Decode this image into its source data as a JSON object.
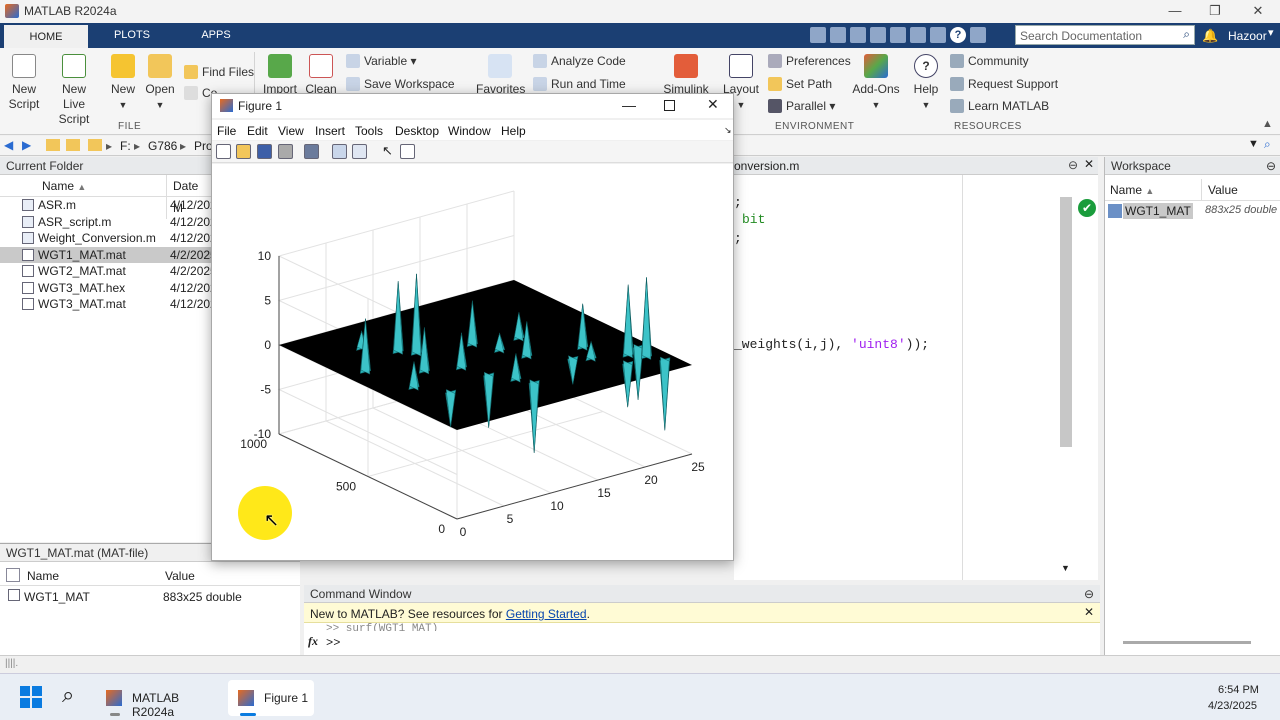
{
  "app": {
    "title": "MATLAB R2024a"
  },
  "tabs": [
    {
      "label": "HOME"
    },
    {
      "label": "PLOTS"
    },
    {
      "label": "APPS"
    }
  ],
  "search": {
    "placeholder": "Search Documentation"
  },
  "user": {
    "name": "Hazoor"
  },
  "ribbon": {
    "file": {
      "new_script": "New\nScript",
      "new_live": "New\nLive Script",
      "new": "New",
      "open": "Open",
      "find_files": "Find Files",
      "compare": "Co",
      "group": "FILE"
    },
    "variable": {
      "import": "Import",
      "clean": "Clean",
      "variable": "Variable",
      "save_ws": "Save Workspace"
    },
    "code": {
      "favorites": "Favorites",
      "analyze": "Analyze Code",
      "run_time": "Run and Time"
    },
    "simulink": {
      "label": "Simulink"
    },
    "env": {
      "layout": "Layout",
      "preferences": "Preferences",
      "set_path": "Set Path",
      "parallel": "Parallel",
      "addons": "Add-Ons",
      "group": "ENVIRONMENT"
    },
    "resources": {
      "help": "Help",
      "community": "Community",
      "request_support": "Request Support",
      "learn": "Learn MATLAB",
      "group": "RESOURCES"
    }
  },
  "address": {
    "drive": "F:",
    "folder1": "G786",
    "folder2": "Pro"
  },
  "current_folder": {
    "title": "Current Folder",
    "col_name": "Name",
    "col_date": "Date M",
    "files": [
      {
        "name": "ASR.m",
        "date": "4/12/202"
      },
      {
        "name": "ASR_script.m",
        "date": "4/12/202"
      },
      {
        "name": "Weight_Conversion.m",
        "date": "4/12/202"
      },
      {
        "name": "WGT1_MAT.mat",
        "date": "4/2/2025"
      },
      {
        "name": "WGT2_MAT.mat",
        "date": "4/2/2025"
      },
      {
        "name": "WGT3_MAT.hex",
        "date": "4/12/202"
      },
      {
        "name": "WGT3_MAT.mat",
        "date": "4/12/202"
      }
    ]
  },
  "details": {
    "title": "WGT1_MAT.mat  (MAT-file)",
    "col_name": "Name",
    "col_value": "Value",
    "var_name": "WGT1_MAT",
    "var_value": "883x25 double"
  },
  "editor": {
    "tab": "onversion.m",
    "line1": ";",
    "line2": "bit",
    "line3": ";",
    "line4_a": "_weights(i,j), ",
    "line4_b": "'uint8'",
    "line4_c": "));"
  },
  "workspace": {
    "title": "Workspace",
    "col_name": "Name",
    "col_value": "Value",
    "var_name": "WGT1_MAT",
    "var_value": "883x25 double"
  },
  "command": {
    "title": "Command Window",
    "banner": "New to MATLAB? See resources for ",
    "banner_link": "Getting Started",
    "banner_end": ".",
    "history": ">> surf(WGT1_MAT)",
    "prompt": ">>",
    "fx": "fx"
  },
  "figure": {
    "title": "Figure 1",
    "menu": [
      "File",
      "Edit",
      "View",
      "Insert",
      "Tools",
      "Desktop",
      "Window",
      "Help"
    ],
    "surface_color": "#27b0b6"
  },
  "chart_data": {
    "type": "surface",
    "title": "",
    "xlabel": "",
    "ylabel": "",
    "zlabel": "",
    "x_ticks": [
      "0",
      "5",
      "10",
      "15",
      "20",
      "25"
    ],
    "y_ticks": [
      "0",
      "500",
      "1000"
    ],
    "z_ticks": [
      "-10",
      "-5",
      "0",
      "5",
      "10"
    ],
    "xlim": [
      0,
      25
    ],
    "ylim": [
      0,
      1000
    ],
    "zlim": [
      -10,
      10
    ],
    "grid": true,
    "spikes": [
      {
        "x": 2,
        "y": 620,
        "z": 6
      },
      {
        "x": 3,
        "y": 400,
        "z": 3
      },
      {
        "x": 5,
        "y": 300,
        "z": -4
      },
      {
        "x": 6,
        "y": 500,
        "z": 5
      },
      {
        "x": 7,
        "y": 700,
        "z": 8
      },
      {
        "x": 8,
        "y": 650,
        "z": 9
      },
      {
        "x": 9,
        "y": 450,
        "z": 4
      },
      {
        "x": 10,
        "y": 350,
        "z": -6
      },
      {
        "x": 11,
        "y": 250,
        "z": 3
      },
      {
        "x": 12,
        "y": 200,
        "z": -8
      },
      {
        "x": 13,
        "y": 600,
        "z": 5
      },
      {
        "x": 14,
        "y": 500,
        "z": 2
      },
      {
        "x": 15,
        "y": 400,
        "z": 4
      },
      {
        "x": 17,
        "y": 550,
        "z": 3
      },
      {
        "x": 18,
        "y": 300,
        "z": -3
      },
      {
        "x": 19,
        "y": 250,
        "z": 2
      },
      {
        "x": 20,
        "y": 350,
        "z": 5
      },
      {
        "x": 21,
        "y": 150,
        "z": -5
      },
      {
        "x": 22,
        "y": 200,
        "z": 8
      },
      {
        "x": 23,
        "y": 150,
        "z": 9
      },
      {
        "x": 24,
        "y": 250,
        "z": -6
      },
      {
        "x": 24,
        "y": 100,
        "z": -8
      },
      {
        "x": 5,
        "y": 800,
        "z": 2
      }
    ]
  },
  "taskbar": {
    "app1": "MATLAB R2024a",
    "app2": "Figure 1",
    "time": "6:54 PM",
    "date": "4/23/2025"
  },
  "colors": {
    "ribbon_tab": "#1b3f73",
    "surface": "#27b0b6",
    "matlab_orange": "#e86a1e"
  }
}
